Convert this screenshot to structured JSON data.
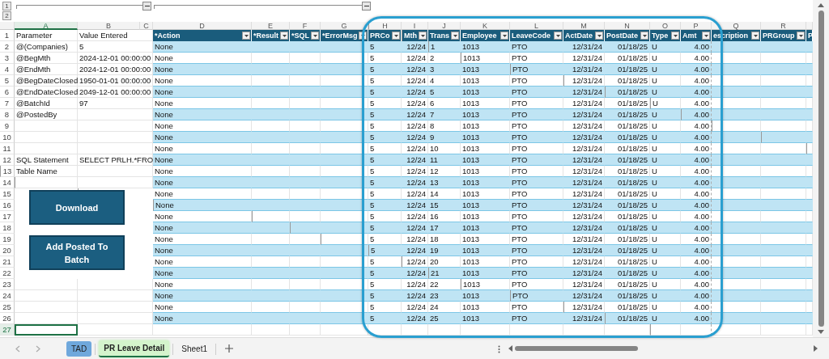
{
  "outline": {
    "levels": [
      "1",
      "2"
    ]
  },
  "columns": [
    {
      "label": "A",
      "selected": true
    },
    {
      "label": "B",
      "selected": false
    },
    {
      "label": "C",
      "selected": false
    },
    {
      "label": "D",
      "selected": false
    },
    {
      "label": "E",
      "selected": false
    },
    {
      "label": "F",
      "selected": false
    },
    {
      "label": "G",
      "selected": false
    },
    {
      "label": "H",
      "selected": false
    },
    {
      "label": "I",
      "selected": false
    },
    {
      "label": "J",
      "selected": false
    },
    {
      "label": "K",
      "selected": false
    },
    {
      "label": "L",
      "selected": false
    },
    {
      "label": "M",
      "selected": false
    },
    {
      "label": "N",
      "selected": false
    },
    {
      "label": "O",
      "selected": false
    },
    {
      "label": "P",
      "selected": false
    },
    {
      "label": "Q",
      "selected": false
    },
    {
      "label": "R",
      "selected": false
    }
  ],
  "row_numbers": [
    {
      "label": "1",
      "selected": false
    },
    {
      "label": "2",
      "selected": false
    },
    {
      "label": "3",
      "selected": false
    },
    {
      "label": "4",
      "selected": false
    },
    {
      "label": "5",
      "selected": false
    },
    {
      "label": "6",
      "selected": false
    },
    {
      "label": "7",
      "selected": false
    },
    {
      "label": "8",
      "selected": false
    },
    {
      "label": "9",
      "selected": false
    },
    {
      "label": "10",
      "selected": false
    },
    {
      "label": "11",
      "selected": false
    },
    {
      "label": "12",
      "selected": false
    },
    {
      "label": "13",
      "selected": false
    },
    {
      "label": "14",
      "selected": false
    },
    {
      "label": "15",
      "selected": false
    },
    {
      "label": "16",
      "selected": false
    },
    {
      "label": "17",
      "selected": false
    },
    {
      "label": "18",
      "selected": false
    },
    {
      "label": "19",
      "selected": false
    },
    {
      "label": "20",
      "selected": false
    },
    {
      "label": "21",
      "selected": false
    },
    {
      "label": "22",
      "selected": false
    },
    {
      "label": "23",
      "selected": false
    },
    {
      "label": "24",
      "selected": false
    },
    {
      "label": "25",
      "selected": false
    },
    {
      "label": "26",
      "selected": false
    },
    {
      "label": "27",
      "selected": true
    }
  ],
  "parameters": [
    {
      "name": "Parameter",
      "value": "Value Entered"
    },
    {
      "name": "@(Companies)",
      "value": "5"
    },
    {
      "name": "@BegMth",
      "value": "2024-12-01 00:00:00"
    },
    {
      "name": "@EndMth",
      "value": "2024-12-01 00:00:00"
    },
    {
      "name": "@BegDateClosed",
      "value": "1950-01-01 00:00:00"
    },
    {
      "name": "@EndDateClosed",
      "value": "2049-12-01 00:00:00"
    },
    {
      "name": "@BatchId",
      "value": "97"
    },
    {
      "name": "@PostedBy"
    }
  ],
  "notes": [
    {
      "name": "SQL Statement",
      "value": "SELECT PRLH.*FRO"
    },
    {
      "name": "Table Name"
    }
  ],
  "buttons": [
    {
      "label": "Download"
    },
    {
      "label": "Add Posted To Batch"
    }
  ],
  "action_table": {
    "columns": [
      {
        "label": "*Action",
        "filter": true
      },
      {
        "label": "*Result",
        "filter": true
      },
      {
        "label": "*SQL",
        "filter": true
      },
      {
        "label": "*ErrorMsg",
        "filter": true
      }
    ],
    "rows": [
      {
        "action": "None"
      },
      {
        "action": "None"
      },
      {
        "action": "None"
      },
      {
        "action": "None"
      },
      {
        "action": "None"
      },
      {
        "action": "None"
      },
      {
        "action": "None"
      },
      {
        "action": "None"
      },
      {
        "action": "None"
      },
      {
        "action": "None"
      },
      {
        "action": "None"
      },
      {
        "action": "None"
      },
      {
        "action": "None"
      },
      {
        "action": "None"
      },
      {
        "action": "None"
      },
      {
        "action": "None"
      },
      {
        "action": "None"
      },
      {
        "action": "None"
      },
      {
        "action": "None"
      },
      {
        "action": "None"
      },
      {
        "action": "None"
      },
      {
        "action": "None"
      },
      {
        "action": "None"
      },
      {
        "action": "None"
      },
      {
        "action": "None"
      }
    ]
  },
  "leave_table": {
    "columns": [
      {
        "label": "PRCo",
        "filter": true
      },
      {
        "label": "Mth",
        "filter": true
      },
      {
        "label": "Trans",
        "filter": true
      },
      {
        "label": "Employee",
        "filter": true
      },
      {
        "label": "LeaveCode",
        "filter": true
      },
      {
        "label": "ActDate",
        "filter": true
      },
      {
        "label": "PostDate",
        "filter": true
      },
      {
        "label": "Type",
        "filter": true
      },
      {
        "label": "Amt",
        "filter": true
      },
      {
        "label": "escription",
        "filter": true
      },
      {
        "label": "PRGroup",
        "filter": true
      },
      {
        "label": "P"
      }
    ],
    "rows": [
      {
        "prco": "5",
        "mth": "12/24",
        "trans": "1",
        "employee": "1013",
        "leave_code": "PTO",
        "act_date": "12/31/24",
        "post_date": "01/18/25",
        "type": "U",
        "amt": "4.00"
      },
      {
        "prco": "5",
        "mth": "12/24",
        "trans": "2",
        "employee": "1013",
        "leave_code": "PTO",
        "act_date": "12/31/24",
        "post_date": "01/18/25",
        "type": "U",
        "amt": "4.00"
      },
      {
        "prco": "5",
        "mth": "12/24",
        "trans": "3",
        "employee": "1013",
        "leave_code": "PTO",
        "act_date": "12/31/24",
        "post_date": "01/18/25",
        "type": "U",
        "amt": "4.00"
      },
      {
        "prco": "5",
        "mth": "12/24",
        "trans": "4",
        "employee": "1013",
        "leave_code": "PTO",
        "act_date": "12/31/24",
        "post_date": "01/18/25",
        "type": "U",
        "amt": "4.00"
      },
      {
        "prco": "5",
        "mth": "12/24",
        "trans": "5",
        "employee": "1013",
        "leave_code": "PTO",
        "act_date": "12/31/24",
        "post_date": "01/18/25",
        "type": "U",
        "amt": "4.00"
      },
      {
        "prco": "5",
        "mth": "12/24",
        "trans": "6",
        "employee": "1013",
        "leave_code": "PTO",
        "act_date": "12/31/24",
        "post_date": "01/18/25",
        "type": "U",
        "amt": "4.00"
      },
      {
        "prco": "5",
        "mth": "12/24",
        "trans": "7",
        "employee": "1013",
        "leave_code": "PTO",
        "act_date": "12/31/24",
        "post_date": "01/18/25",
        "type": "U",
        "amt": "4.00"
      },
      {
        "prco": "5",
        "mth": "12/24",
        "trans": "8",
        "employee": "1013",
        "leave_code": "PTO",
        "act_date": "12/31/24",
        "post_date": "01/18/25",
        "type": "U",
        "amt": "4.00"
      },
      {
        "prco": "5",
        "mth": "12/24",
        "trans": "9",
        "employee": "1013",
        "leave_code": "PTO",
        "act_date": "12/31/24",
        "post_date": "01/18/25",
        "type": "U",
        "amt": "4.00"
      },
      {
        "prco": "5",
        "mth": "12/24",
        "trans": "10",
        "employee": "1013",
        "leave_code": "PTO",
        "act_date": "12/31/24",
        "post_date": "01/18/25",
        "type": "U",
        "amt": "4.00"
      },
      {
        "prco": "5",
        "mth": "12/24",
        "trans": "11",
        "employee": "1013",
        "leave_code": "PTO",
        "act_date": "12/31/24",
        "post_date": "01/18/25",
        "type": "U",
        "amt": "4.00"
      },
      {
        "prco": "5",
        "mth": "12/24",
        "trans": "12",
        "employee": "1013",
        "leave_code": "PTO",
        "act_date": "12/31/24",
        "post_date": "01/18/25",
        "type": "U",
        "amt": "4.00"
      },
      {
        "prco": "5",
        "mth": "12/24",
        "trans": "13",
        "employee": "1013",
        "leave_code": "PTO",
        "act_date": "12/31/24",
        "post_date": "01/18/25",
        "type": "U",
        "amt": "4.00"
      },
      {
        "prco": "5",
        "mth": "12/24",
        "trans": "14",
        "employee": "1013",
        "leave_code": "PTO",
        "act_date": "12/31/24",
        "post_date": "01/18/25",
        "type": "U",
        "amt": "4.00"
      },
      {
        "prco": "5",
        "mth": "12/24",
        "trans": "15",
        "employee": "1013",
        "leave_code": "PTO",
        "act_date": "12/31/24",
        "post_date": "01/18/25",
        "type": "U",
        "amt": "4.00"
      },
      {
        "prco": "5",
        "mth": "12/24",
        "trans": "16",
        "employee": "1013",
        "leave_code": "PTO",
        "act_date": "12/31/24",
        "post_date": "01/18/25",
        "type": "U",
        "amt": "4.00"
      },
      {
        "prco": "5",
        "mth": "12/24",
        "trans": "17",
        "employee": "1013",
        "leave_code": "PTO",
        "act_date": "12/31/24",
        "post_date": "01/18/25",
        "type": "U",
        "amt": "4.00"
      },
      {
        "prco": "5",
        "mth": "12/24",
        "trans": "18",
        "employee": "1013",
        "leave_code": "PTO",
        "act_date": "12/31/24",
        "post_date": "01/18/25",
        "type": "U",
        "amt": "4.00"
      },
      {
        "prco": "5",
        "mth": "12/24",
        "trans": "19",
        "employee": "1013",
        "leave_code": "PTO",
        "act_date": "12/31/24",
        "post_date": "01/18/25",
        "type": "U",
        "amt": "4.00"
      },
      {
        "prco": "5",
        "mth": "12/24",
        "trans": "20",
        "employee": "1013",
        "leave_code": "PTO",
        "act_date": "12/31/24",
        "post_date": "01/18/25",
        "type": "U",
        "amt": "4.00"
      },
      {
        "prco": "5",
        "mth": "12/24",
        "trans": "21",
        "employee": "1013",
        "leave_code": "PTO",
        "act_date": "12/31/24",
        "post_date": "01/18/25",
        "type": "U",
        "amt": "4.00"
      },
      {
        "prco": "5",
        "mth": "12/24",
        "trans": "22",
        "employee": "1013",
        "leave_code": "PTO",
        "act_date": "12/31/24",
        "post_date": "01/18/25",
        "type": "U",
        "amt": "4.00"
      },
      {
        "prco": "5",
        "mth": "12/24",
        "trans": "23",
        "employee": "1013",
        "leave_code": "PTO",
        "act_date": "12/31/24",
        "post_date": "01/18/25",
        "type": "U",
        "amt": "4.00"
      },
      {
        "prco": "5",
        "mth": "12/24",
        "trans": "24",
        "employee": "1013",
        "leave_code": "PTO",
        "act_date": "12/31/24",
        "post_date": "01/18/25",
        "type": "U",
        "amt": "4.00"
      },
      {
        "prco": "5",
        "mth": "12/24",
        "trans": "25",
        "employee": "1013",
        "leave_code": "PTO",
        "act_date": "12/31/24",
        "post_date": "01/18/25",
        "type": "U",
        "amt": "4.00"
      }
    ]
  },
  "sheet_tabs": [
    {
      "label": "TAD",
      "selected": false,
      "color": "#6fa8dc"
    },
    {
      "label": "PR Leave Detail",
      "selected": true,
      "color": "#d4f4cc"
    },
    {
      "label": "Sheet1",
      "selected": false
    }
  ]
}
